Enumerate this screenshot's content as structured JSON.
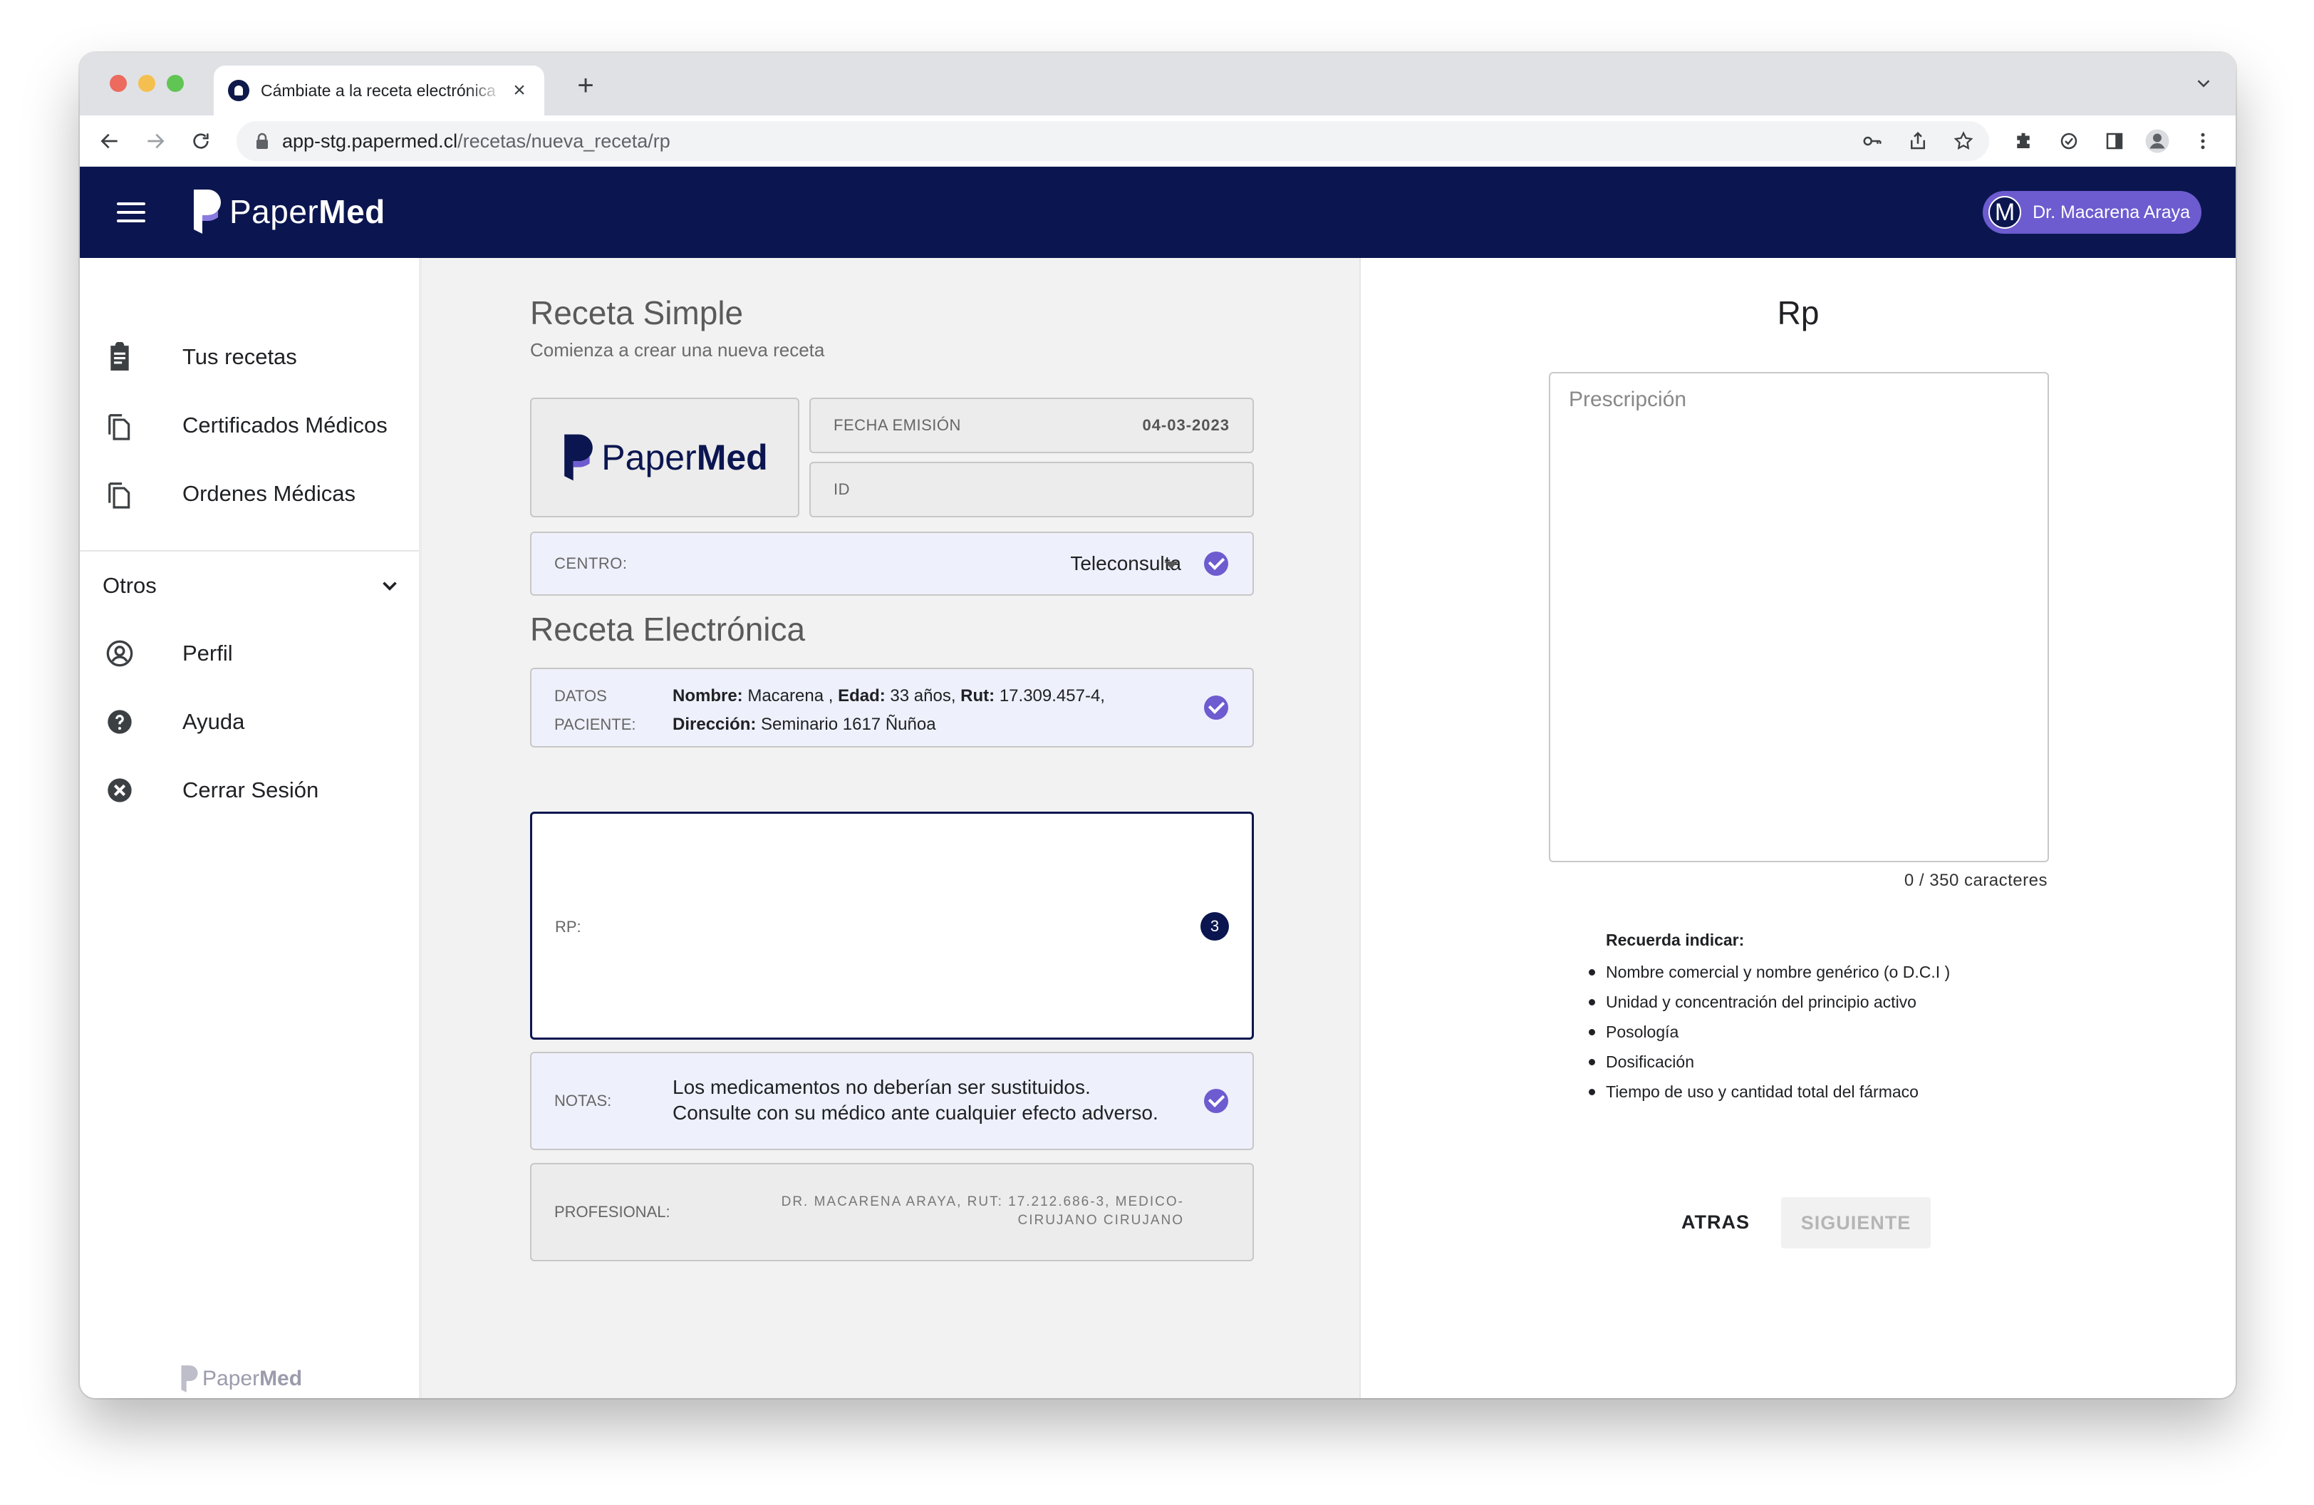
{
  "browser": {
    "tab_title": "Cámbiate a la receta electrónica",
    "url_host": "app-stg.papermed.cl",
    "url_path": "/recetas/nueva_receta/rp"
  },
  "header": {
    "brand_regular": "Paper",
    "brand_bold": "Med",
    "avatar_letter": "M",
    "user_name": "Dr. Macarena Araya",
    "colors": {
      "header_bg": "#0b1650",
      "accent": "#6d5bd0"
    }
  },
  "sidebar": {
    "items": [
      {
        "label": "Tus recetas",
        "icon": "clipboard-icon"
      },
      {
        "label": "Certificados Médicos",
        "icon": "copy-icon"
      },
      {
        "label": "Ordenes Médicas",
        "icon": "copy-icon"
      }
    ],
    "otros_label": "Otros",
    "otros_items": [
      {
        "label": "Perfil",
        "icon": "account-circle-icon"
      },
      {
        "label": "Ayuda",
        "icon": "help-icon"
      },
      {
        "label": "Cerrar Sesión",
        "icon": "cancel-icon"
      }
    ],
    "footer_regular": "Paper",
    "footer_bold": "Med"
  },
  "form": {
    "title": "Receta Simple",
    "subtitle": "Comienza a crear una nueva receta",
    "logo_regular": "Paper",
    "logo_bold": "Med",
    "fecha_label": "FECHA EMISIÓN",
    "fecha_value": "04-03-2023",
    "id_label": "ID",
    "centro_label": "CENTRO:",
    "centro_value": "Teleconsulta",
    "section_title": "Receta Electrónica",
    "datos_label_1": "DATOS",
    "datos_label_2": "PACIENTE:",
    "paciente": {
      "nombre_label": "Nombre:",
      "nombre": "Macarena ,",
      "edad_label": "Edad:",
      "edad": "33 años,",
      "rut_label": "Rut:",
      "rut": "17.309.457-4,",
      "direccion_label": "Dirección:",
      "direccion": "Seminario 1617 Ñuñoa"
    },
    "rp_label": "RP:",
    "rp_badge": "3",
    "notas_label": "NOTAS:",
    "notas_line_1": "Los medicamentos no deberían ser sustituidos.",
    "notas_line_2": "Consulte con su médico ante cualquier efecto adverso.",
    "profesional_label": "PROFESIONAL:",
    "profesional_line_1": "DR. MACARENA ARAYA, RUT: 17.212.686-3, MEDICO-",
    "profesional_line_2": "CIRUJANO CIRUJANO"
  },
  "rp_panel": {
    "title": "Rp",
    "placeholder": "Prescripción",
    "char_count": "0 / 350 caracteres",
    "recuerda_title": "Recuerda indicar:",
    "recuerda_items": [
      "Nombre comercial y nombre genérico (o D.C.I )",
      "Unidad y concentración del principio activo",
      "Posología",
      "Dosificación",
      "Tiempo de uso y cantidad total del fármaco"
    ],
    "btn_atras": "ATRAS",
    "btn_siguiente": "SIGUIENTE"
  }
}
